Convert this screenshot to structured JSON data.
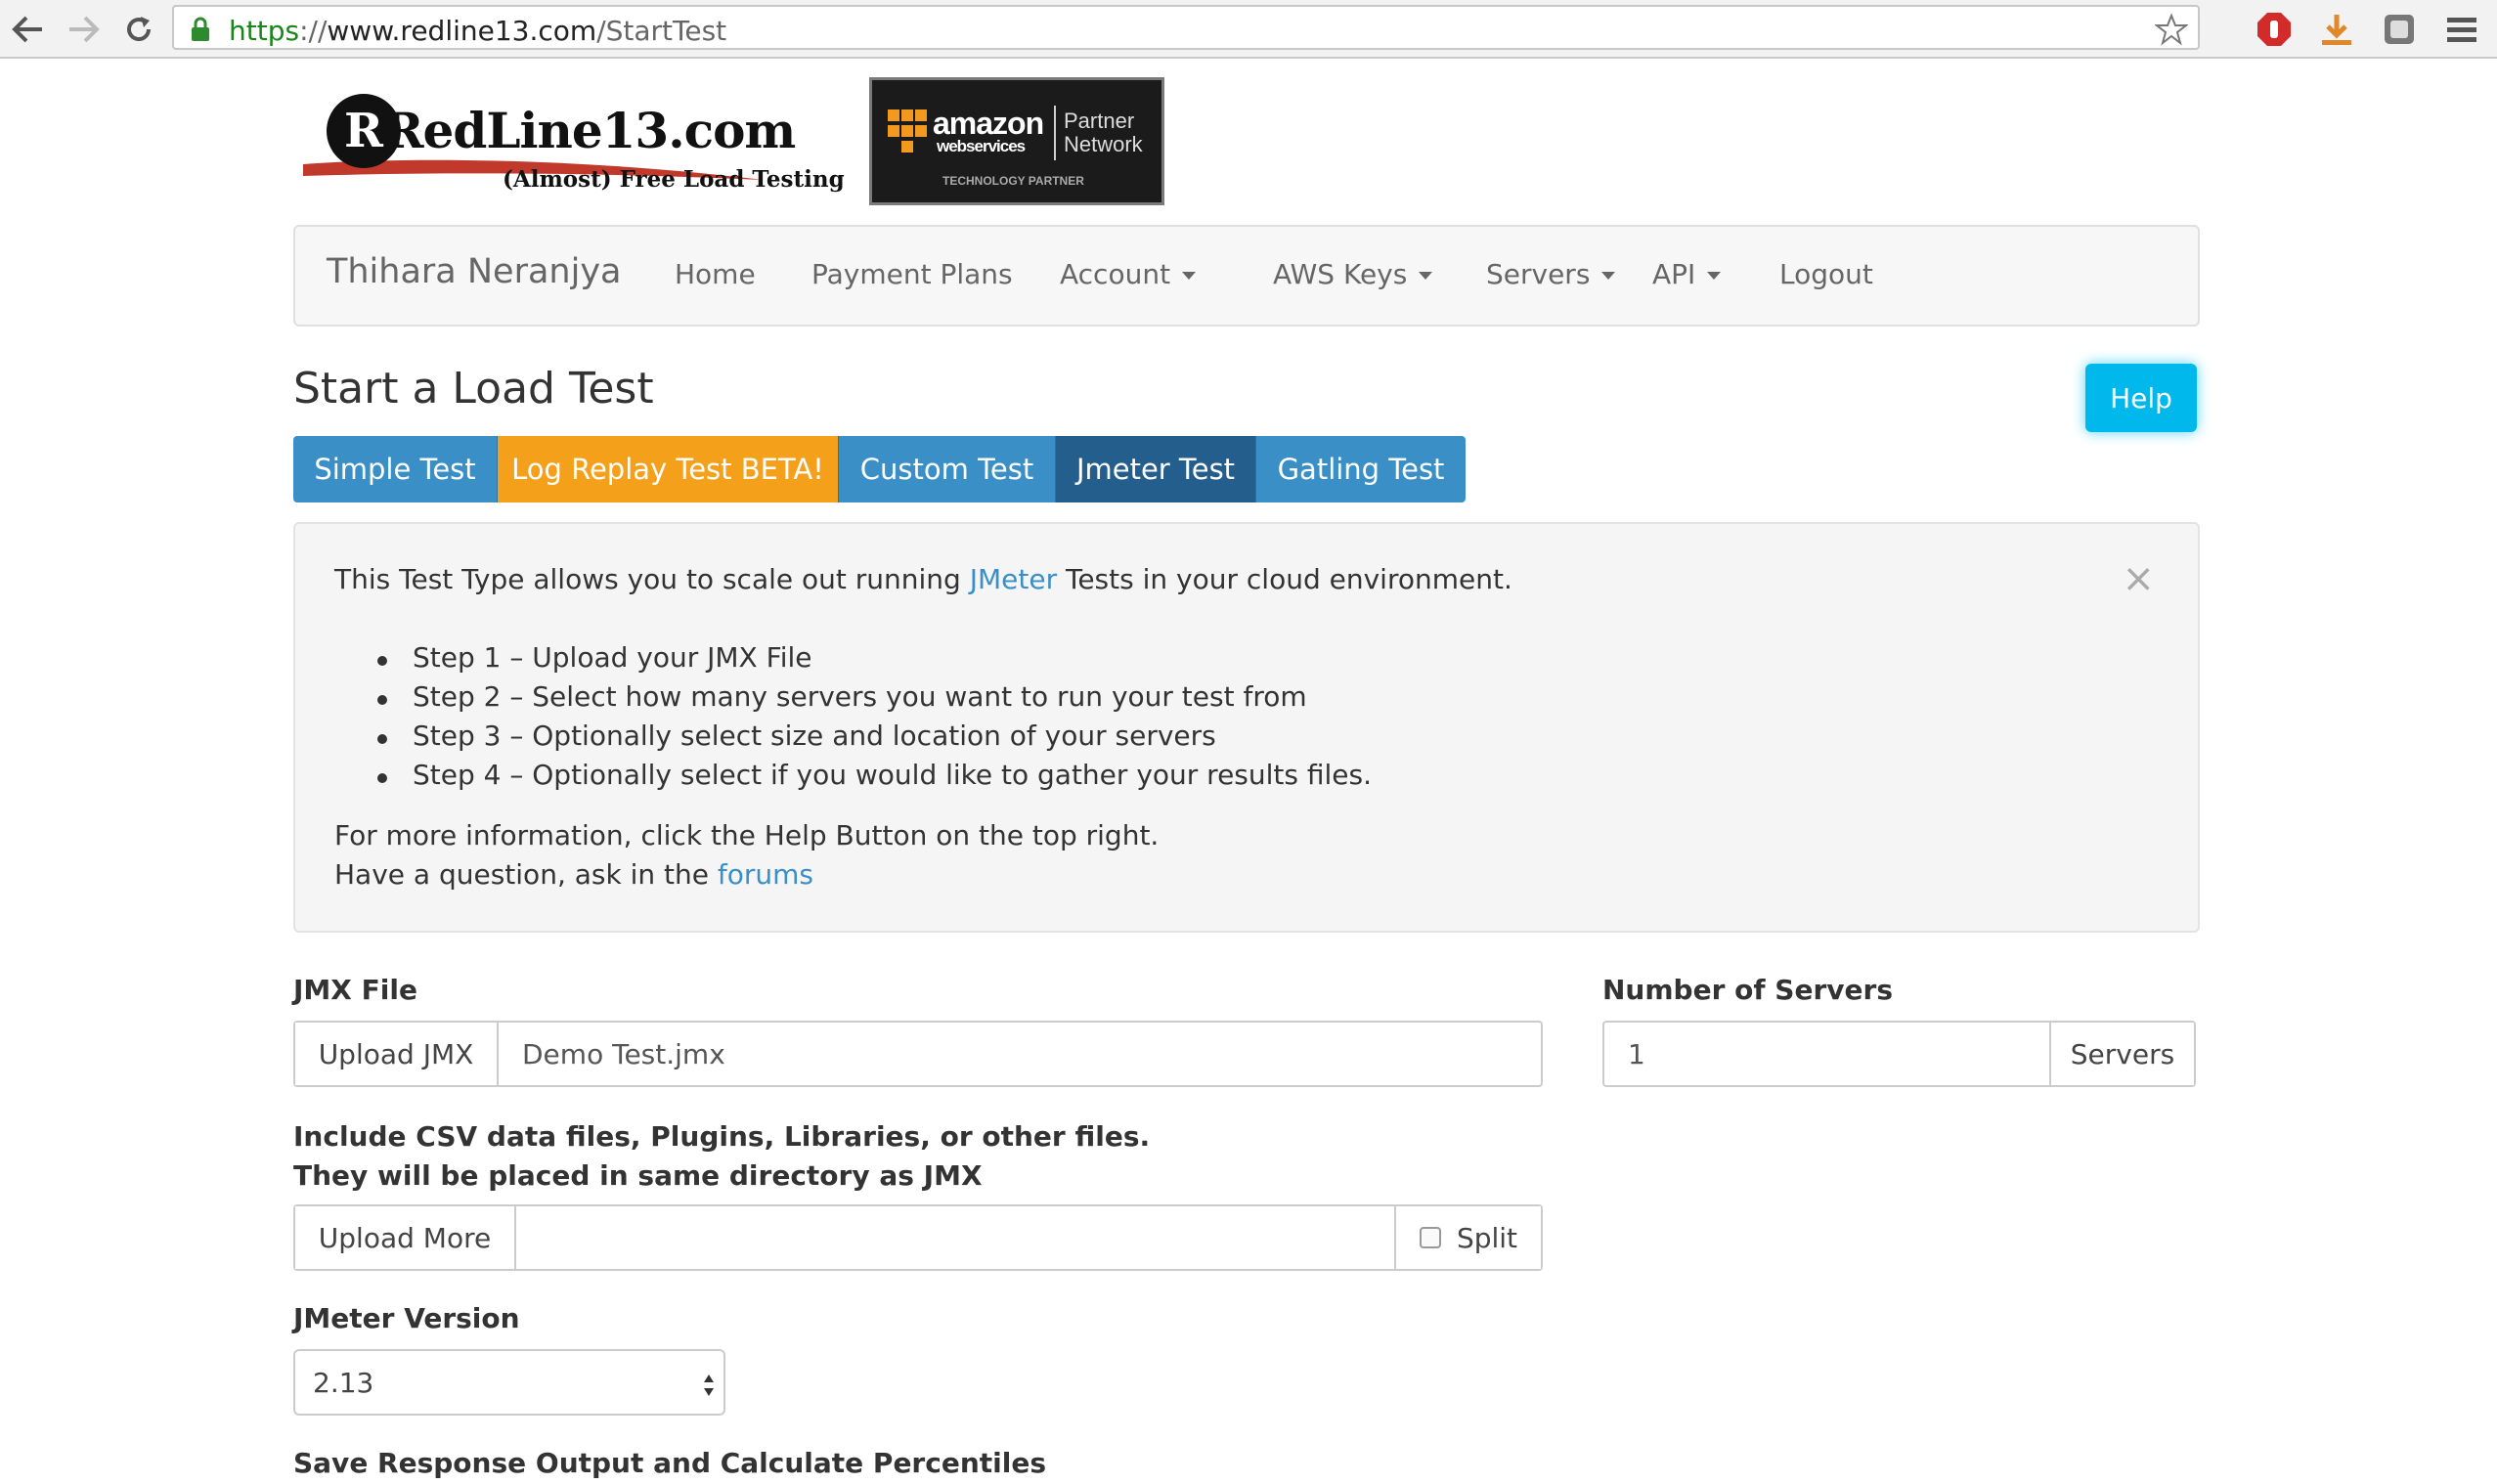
{
  "browser": {
    "url_scheme": "https",
    "url_sep": "://",
    "url_host": "www.redline13.com",
    "url_path": "/StartTest"
  },
  "logo": {
    "name": "RedLine13.com",
    "tagline": "(Almost) Free Load Testing"
  },
  "aws_badge": {
    "amazon": "amazon",
    "web_services": "webservices",
    "partner": "Partner",
    "network": "Network",
    "tech": "TECHNOLOGY PARTNER"
  },
  "navbar": {
    "brand": "Thihara Neranjya",
    "items": [
      {
        "label": "Home",
        "dropdown": false
      },
      {
        "label": "Payment Plans",
        "dropdown": false
      },
      {
        "label": "Account",
        "dropdown": true
      },
      {
        "label": "AWS Keys",
        "dropdown": true
      },
      {
        "label": "Servers",
        "dropdown": true
      },
      {
        "label": "API",
        "dropdown": true
      },
      {
        "label": "Logout",
        "dropdown": false
      }
    ]
  },
  "page": {
    "title": "Start a Load Test",
    "help_label": "Help"
  },
  "tabs": [
    {
      "label": "Simple Test",
      "active": false
    },
    {
      "label": "Log Replay Test BETA!",
      "active": false
    },
    {
      "label": "Custom Test",
      "active": false
    },
    {
      "label": "Jmeter Test",
      "active": true
    },
    {
      "label": "Gatling Test",
      "active": false
    }
  ],
  "info": {
    "intro_before": "This Test Type allows you to scale out running ",
    "intro_link": "JMeter",
    "intro_after": " Tests in your cloud environment.",
    "steps": [
      "Step 1 – Upload your JMX File",
      "Step 2 – Select how many servers you want to run your test from",
      "Step 3 – Optionally select size and location of your servers",
      "Step 4 – Optionally select if you would like to gather your results files."
    ],
    "more_info": "For more information, click the Help Button on the top right.",
    "question_before": "Have a question, ask in the ",
    "question_link": "forums",
    "close_symbol": "×"
  },
  "form": {
    "jmx_label": "JMX File",
    "upload_jmx": "Upload JMX",
    "jmx_value": "Demo Test.jmx",
    "servers_label": "Number of Servers",
    "servers_value": "1",
    "servers_addon": "Servers",
    "extra_label_1": "Include CSV data files, Plugins, Libraries, or other files.",
    "extra_label_2": "They will be placed in same directory as JMX",
    "upload_more": "Upload More",
    "upload_more_value": "",
    "split_label": "Split",
    "split_checked": false,
    "version_label": "JMeter Version",
    "version_value": "2.13",
    "save_label": "Save Response Output and Calculate Percentiles"
  },
  "colors": {
    "tab_blue": "#3a8fc7",
    "tab_orange": "#f5a01a",
    "tab_active": "#245e8c",
    "help": "#00b8ec",
    "link": "#3a8fc7"
  }
}
